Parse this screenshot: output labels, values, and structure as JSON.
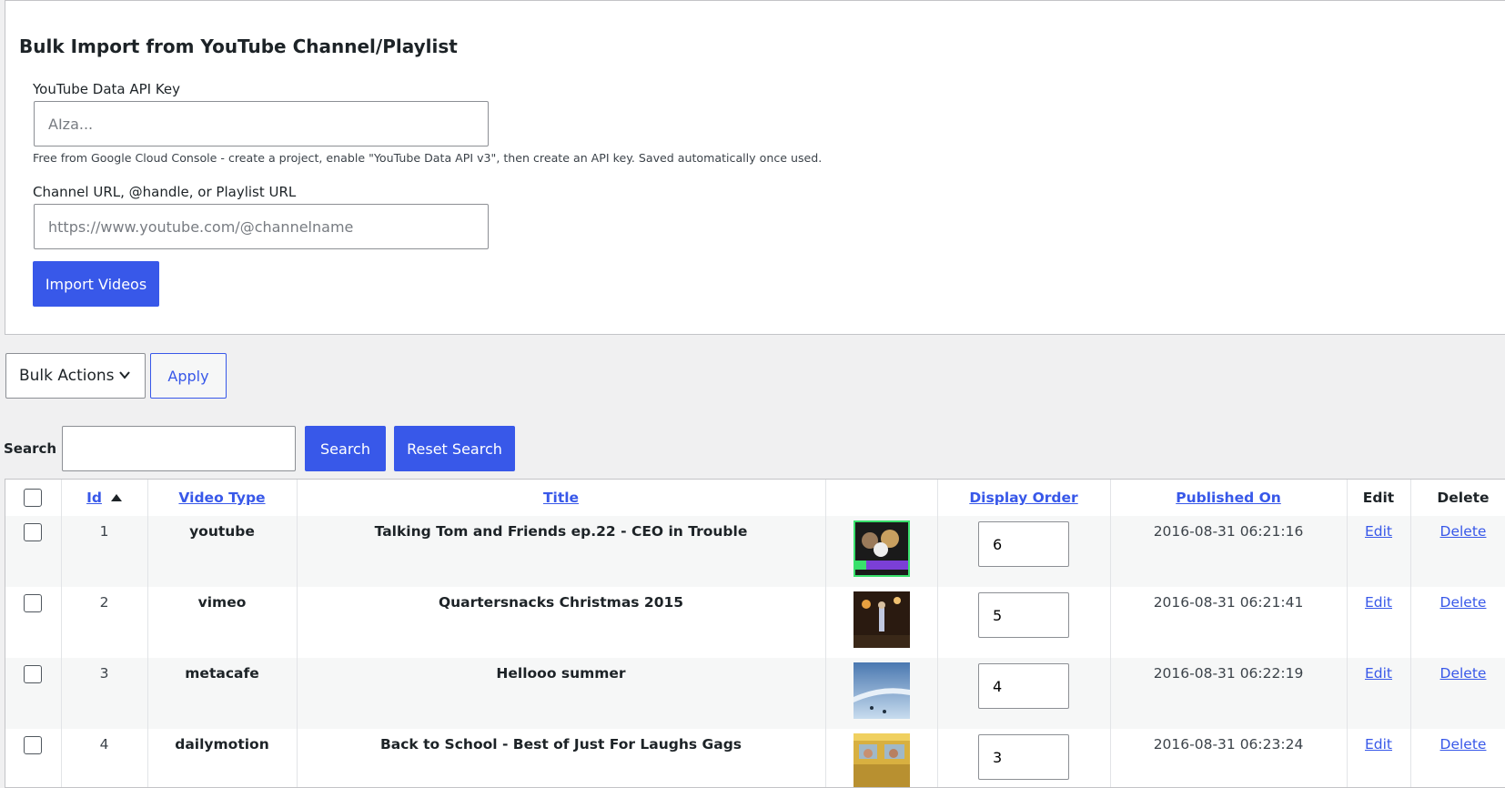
{
  "import_form": {
    "title": "Bulk Import from YouTube Channel/Playlist",
    "api_key_label": "YouTube Data API Key",
    "api_key_value": "",
    "api_key_placeholder": "AIza...",
    "api_key_help": "Free from Google Cloud Console - create a project, enable \"YouTube Data API v3\", then create an API key. Saved automatically once used.",
    "channel_label": "Channel URL, @handle, or Playlist URL",
    "channel_value": "",
    "channel_placeholder": "https://www.youtube.com/@channelname",
    "import_button": "Import Videos"
  },
  "bulk_actions": {
    "selected": "Bulk Actions",
    "apply_label": "Apply"
  },
  "search": {
    "label": "Search :",
    "value": "",
    "search_button": "Search",
    "reset_button": "Reset Search"
  },
  "table": {
    "headers": {
      "id": "Id",
      "video_type": "Video Type",
      "title": "Title",
      "display_order": "Display Order",
      "published_on": "Published On",
      "edit": "Edit",
      "delete": "Delete"
    },
    "sort": {
      "column": "id",
      "direction": "ascending"
    },
    "rows": [
      {
        "id": "1",
        "video_type": "youtube",
        "title": "Talking Tom and Friends ep.22 - CEO in Trouble",
        "display_order": "6",
        "published_on": "2016-08-31 06:21:16",
        "edit": "Edit",
        "delete": "Delete"
      },
      {
        "id": "2",
        "video_type": "vimeo",
        "title": "Quartersnacks Christmas 2015",
        "display_order": "5",
        "published_on": "2016-08-31 06:21:41",
        "edit": "Edit",
        "delete": "Delete"
      },
      {
        "id": "3",
        "video_type": "metacafe",
        "title": "Hellooo summer",
        "display_order": "4",
        "published_on": "2016-08-31 06:22:19",
        "edit": "Edit",
        "delete": "Delete"
      },
      {
        "id": "4",
        "video_type": "dailymotion",
        "title": "Back to School - Best of Just For Laughs Gags",
        "display_order": "3",
        "published_on": "2016-08-31 06:23:24",
        "edit": "Edit",
        "delete": "Delete"
      }
    ]
  },
  "icons": {
    "select_chevron": "chevron-down-icon",
    "sort_indicator": "sort-up-icon"
  },
  "colors": {
    "accent": "#3858e9",
    "background": "#f0f0f1",
    "panel": "#ffffff",
    "border": "#c3c4c7",
    "text": "#1d2327"
  }
}
